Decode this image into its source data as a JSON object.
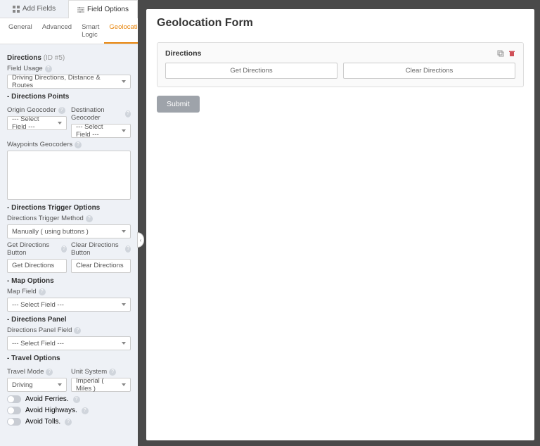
{
  "tabs_top": {
    "add_fields": "Add Fields",
    "field_options": "Field Options"
  },
  "tabs_sub": {
    "general": "General",
    "advanced": "Advanced",
    "smart_logic": "Smart Logic",
    "geolocation": "Geolocation"
  },
  "header": {
    "title": "Directions",
    "id_suffix": "(ID #5)"
  },
  "field_usage": {
    "label": "Field Usage",
    "value": "Driving Directions, Distance & Routes"
  },
  "sections": {
    "points": "Directions Points",
    "trigger": "Directions Trigger Options",
    "map": "Map Options",
    "panel": "Directions Panel",
    "travel": "Travel Options"
  },
  "origin": {
    "label": "Origin Geocoder",
    "value": "--- Select Field ---"
  },
  "destination": {
    "label": "Destination Geocoder",
    "value": "--- Select Field ---"
  },
  "waypoints": {
    "label": "Waypoints Geocoders"
  },
  "trigger_method": {
    "label": "Directions Trigger Method",
    "value": "Manually ( using buttons )"
  },
  "get_btn": {
    "label": "Get Directions Button",
    "value": "Get Directions"
  },
  "clear_btn": {
    "label": "Clear Directions Button",
    "value": "Clear Directions"
  },
  "map_field": {
    "label": "Map Field",
    "value": "--- Select Field ---"
  },
  "panel_field": {
    "label": "Directions Panel Field",
    "value": "--- Select Field ---"
  },
  "travel_mode": {
    "label": "Travel Mode",
    "value": "Driving"
  },
  "unit_system": {
    "label": "Unit System",
    "value": "Imperial ( Miles )"
  },
  "toggles": {
    "ferries": "Avoid Ferries.",
    "highways": "Avoid Highways.",
    "tolls": "Avoid Tolls."
  },
  "form": {
    "title": "Geolocation Form",
    "field_label": "Directions",
    "get_directions": "Get Directions",
    "clear_directions": "Clear Directions",
    "submit": "Submit"
  }
}
